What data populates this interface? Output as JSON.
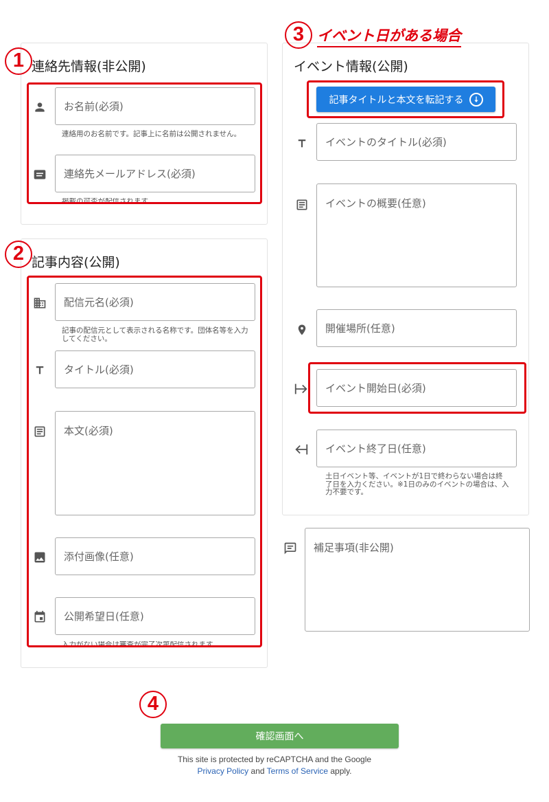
{
  "step_markers": {
    "step1": "1",
    "step2": "2",
    "step3": "3",
    "step4": "4"
  },
  "event_heading": "イベント日がある場合",
  "contact": {
    "title": "連絡先情報(非公開)",
    "name_placeholder": "お名前(必須)",
    "name_hint": "連絡用のお名前です。記事上に名前は公開されません。",
    "email_placeholder": "連絡先メールアドレス(必須)",
    "email_hint": "掲載の可否が配信されます。"
  },
  "article": {
    "title": "記事内容(公開)",
    "publisher_placeholder": "配信元名(必須)",
    "publisher_hint": "記事の配信元として表示される名称です。団体名等を入力してください。",
    "title_placeholder": "タイトル(必須)",
    "body_placeholder": "本文(必須)",
    "image_placeholder": "添付画像(任意)",
    "date_placeholder": "公開希望日(任意)",
    "date_hint": "入力がない場合は審査が完了次第配信されます。"
  },
  "event": {
    "title": "イベント情報(公開)",
    "copy_button": "記事タイトルと本文を転記する",
    "title_placeholder": "イベントのタイトル(必須)",
    "summary_placeholder": "イベントの概要(任意)",
    "place_placeholder": "開催場所(任意)",
    "start_placeholder": "イベント開始日(必須)",
    "end_placeholder": "イベント終了日(任意)",
    "end_hint": "土日イベント等、イベントが1日で終わらない場合は終了日を入力ください。※1日のみのイベントの場合は、入力不要です。"
  },
  "notes": {
    "placeholder": "補足事項(非公開)"
  },
  "submit": {
    "label": "確認画面へ"
  },
  "recaptcha": {
    "line1": "This site is protected by reCAPTCHA and the Google",
    "privacy": "Privacy Policy",
    "and": "and",
    "terms": "Terms of Service",
    "apply": "apply."
  },
  "colors": {
    "annotation_red": "#e0000f",
    "copy_button_blue": "#1f7ee0",
    "submit_green": "#62ad5c",
    "link_blue": "#2a63b5"
  }
}
